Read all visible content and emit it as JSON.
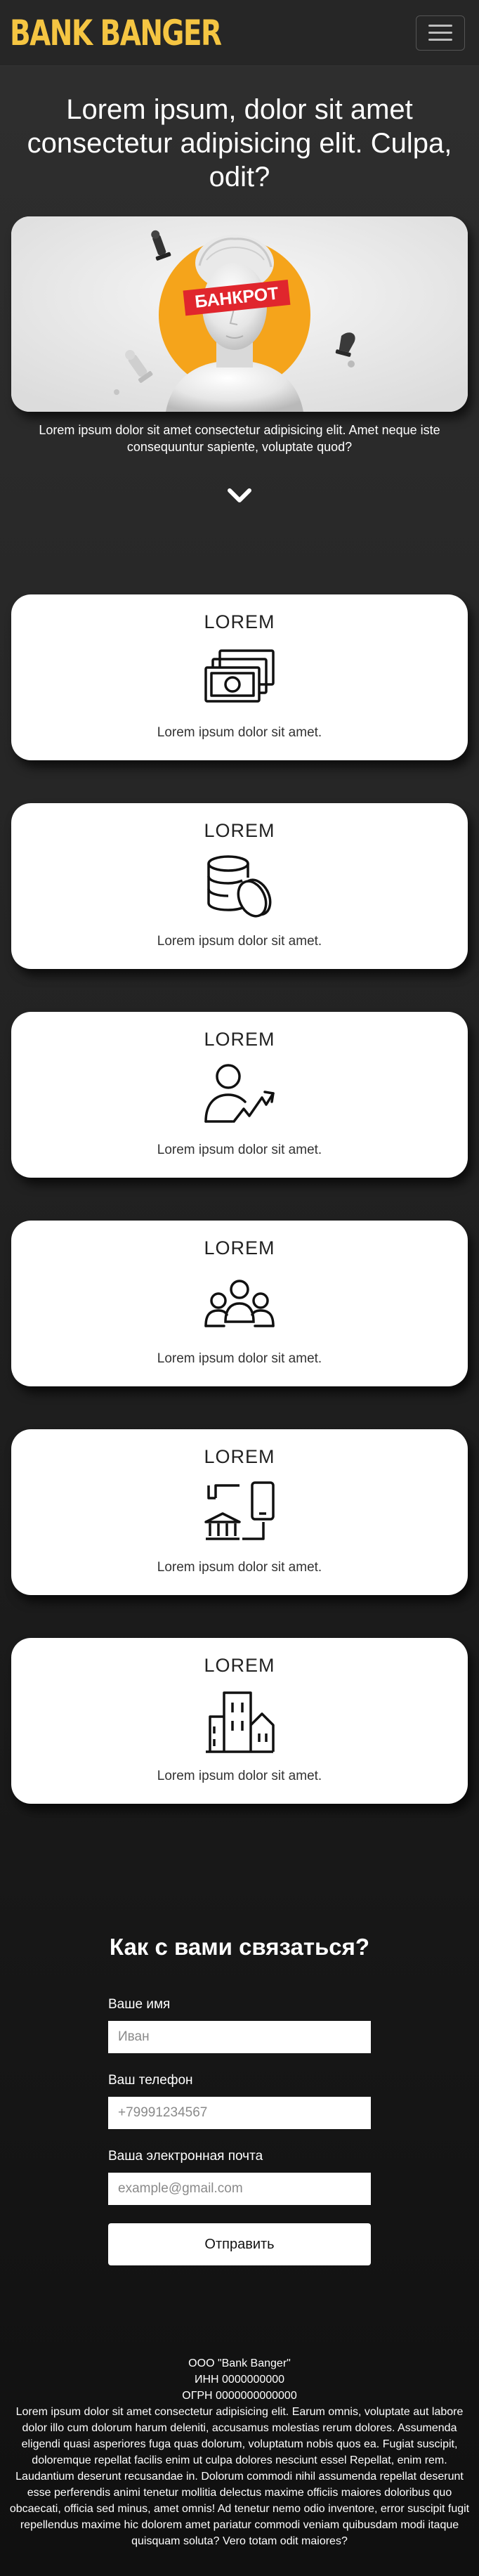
{
  "header": {
    "brand": "BANK BANGER",
    "menu_toggle_icon": "hamburger-icon"
  },
  "hero": {
    "title": "Lorem ipsum, dolor sit amet consectetur adipisicing elit. Culpa, odit?",
    "stamp_text": "БАНКРОТ",
    "description": "Lorem ipsum dolor sit amet consectetur adipisicing elit. Amet neque iste consequuntur sapiente, voluptate quod?",
    "scroll_icon": "chevron-down-icon",
    "colors": {
      "accent": "#f5a41b",
      "stamp": "#e0262d"
    }
  },
  "features": [
    {
      "title": "LOREM",
      "icon": "cash-icon",
      "text": "Lorem ipsum dolor sit amet."
    },
    {
      "title": "LOREM",
      "icon": "coins-icon",
      "text": "Lorem ipsum dolor sit amet."
    },
    {
      "title": "LOREM",
      "icon": "person-growth-icon",
      "text": "Lorem ipsum dolor sit amet."
    },
    {
      "title": "LOREM",
      "icon": "people-group-icon",
      "text": "Lorem ipsum dolor sit amet."
    },
    {
      "title": "LOREM",
      "icon": "bank-mobile-icon",
      "text": "Lorem ipsum dolor sit amet."
    },
    {
      "title": "LOREM",
      "icon": "buildings-icon",
      "text": "Lorem ipsum dolor sit amet."
    }
  ],
  "contact": {
    "title": "Как с вами связаться?",
    "name_label": "Ваше имя",
    "name_placeholder": "Иван",
    "phone_label": "Ваш телефон",
    "phone_placeholder": "+79991234567",
    "email_label": "Ваша электронная почта",
    "email_placeholder": "example@gmail.com",
    "submit_label": "Отправить"
  },
  "footer": {
    "company": "ООО \"Bank Banger\"",
    "inn": "ИНН 0000000000",
    "ogrn": "ОГРН 0000000000000",
    "text": "Lorem ipsum dolor sit amet consectetur adipisicing elit. Earum omnis, voluptate aut labore dolor illo cum dolorum harum deleniti, accusamus molestias rerum dolores. Assumenda eligendi quasi asperiores fuga quas dolorum, voluptatum nobis quos ea. Fugiat suscipit, doloremque repellat facilis enim ut culpa dolores nesciunt essel Repellat, enim rem. Laudantium deserunt recusandae in. Dolorum commodi nihil assumenda repellat deserunt esse perferendis animi tenetur mollitia delectus maxime officiis maiores doloribus quo obcaecati, officia sed minus, amet omnis! Ad tenetur nemo odio inventore, error suscipit fugit repellendus maxime hic dolorem amet pariatur commodi veniam quibusdam modi itaque quisquam soluta? Vero totam odit maiores?"
  }
}
